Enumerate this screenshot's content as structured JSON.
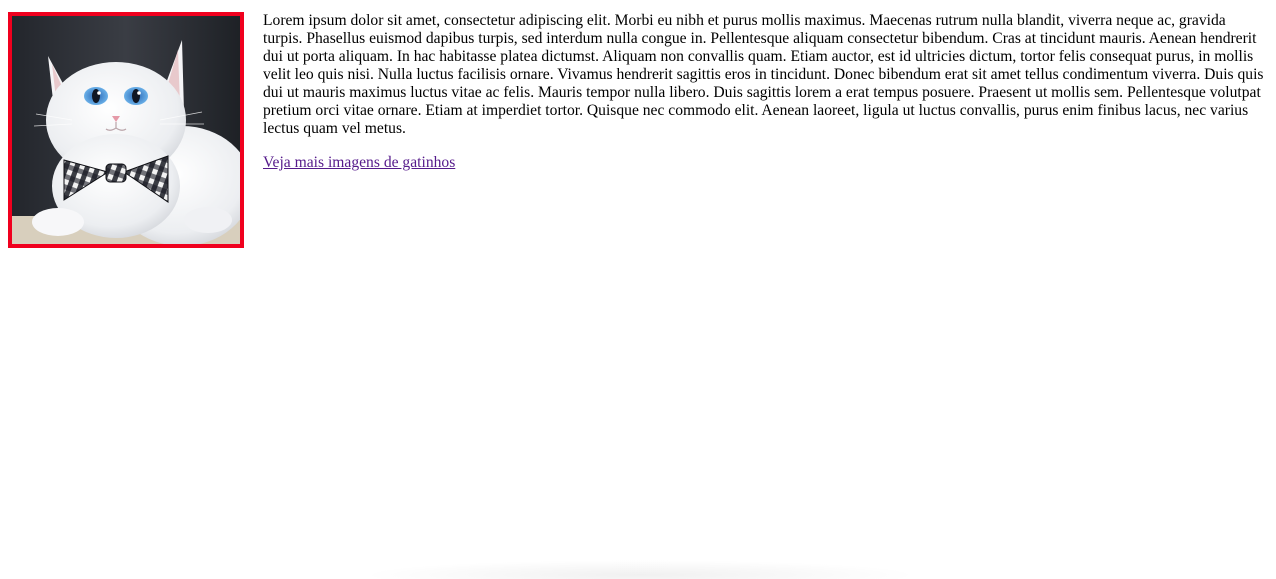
{
  "image": {
    "subject": "white-cat-with-bow-tie",
    "border_color": "#f0001e"
  },
  "article": {
    "paragraph": "Lorem ipsum dolor sit amet, consectetur adipiscing elit. Morbi eu nibh et purus mollis maximus. Maecenas rutrum nulla blandit, viverra neque ac, gravida turpis. Phasellus euismod dapibus turpis, sed interdum nulla congue in. Pellentesque aliquam consectetur bibendum. Cras at tincidunt mauris. Aenean hendrerit dui ut porta aliquam. In hac habitasse platea dictumst. Aliquam non convallis quam. Etiam auctor, est id ultricies dictum, tortor felis consequat purus, in mollis velit leo quis nisi. Nulla luctus facilisis ornare. Vivamus hendrerit sagittis eros in tincidunt. Donec bibendum erat sit amet tellus condimentum viverra. Duis quis dui ut mauris maximus luctus vitae ac felis. Mauris tempor nulla libero. Duis sagittis lorem a erat tempus posuere. Praesent ut mollis sem. Pellentesque volutpat pretium orci vitae ornare. Etiam at imperdiet tortor. Quisque nec commodo elit. Aenean laoreet, ligula ut luctus convallis, purus enim finibus lacus, nec varius lectus quam vel metus.",
    "link_text": "Veja mais imagens de gatinhos",
    "link_color": "#551a8b"
  }
}
